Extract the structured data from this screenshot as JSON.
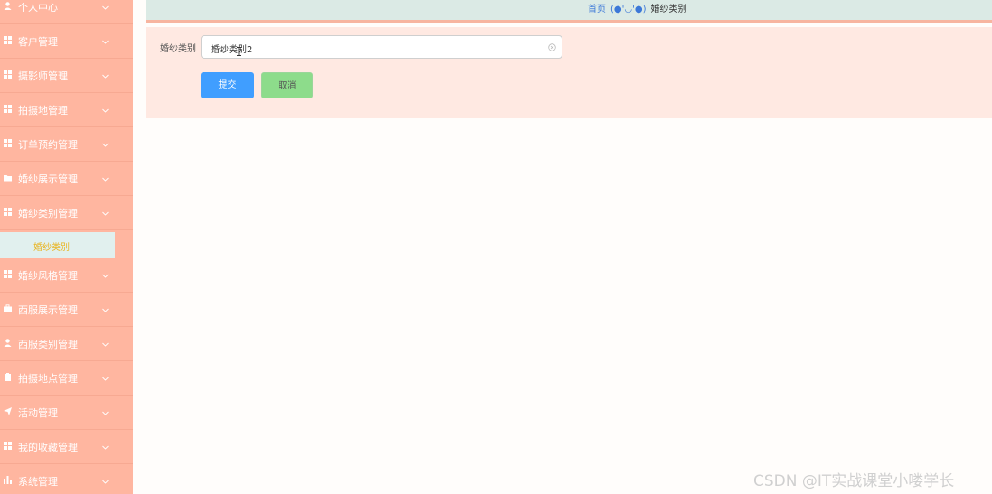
{
  "sidebar": {
    "items": [
      {
        "label": "个人中心",
        "icon": "user-icon"
      },
      {
        "label": "客户管理",
        "icon": "grid-icon"
      },
      {
        "label": "摄影师管理",
        "icon": "grid-icon"
      },
      {
        "label": "拍摄地管理",
        "icon": "grid-icon"
      },
      {
        "label": "订单预约管理",
        "icon": "grid-icon"
      },
      {
        "label": "婚纱展示管理",
        "icon": "folder-icon"
      },
      {
        "label": "婚纱类别管理",
        "icon": "grid-icon"
      },
      {
        "label": "婚纱风格管理",
        "icon": "grid-icon"
      },
      {
        "label": "西服展示管理",
        "icon": "briefcase-icon"
      },
      {
        "label": "西服类别管理",
        "icon": "user-icon"
      },
      {
        "label": "拍摄地点管理",
        "icon": "clipboard-icon"
      },
      {
        "label": "活动管理",
        "icon": "send-icon"
      },
      {
        "label": "我的收藏管理",
        "icon": "grid-icon"
      },
      {
        "label": "系统管理",
        "icon": "chart-icon"
      }
    ],
    "active_sub": "婚纱类别"
  },
  "breadcrumb": {
    "home": "首页",
    "separator": "(●'◡'●)",
    "current": "婚纱类别"
  },
  "form": {
    "label": "婚纱类别",
    "value": "婚纱类别2",
    "submit_label": "提交",
    "cancel_label": "取消"
  },
  "watermark": "CSDN @IT实战课堂小喽学长",
  "colors": {
    "sidebar_bg": "#ffb6a0",
    "topbar_bg": "#dbeae5",
    "panel_bg": "#ffe9e2",
    "submit_bg": "#409eff",
    "cancel_bg": "#8ddc8b",
    "active_text": "#e9b421"
  }
}
